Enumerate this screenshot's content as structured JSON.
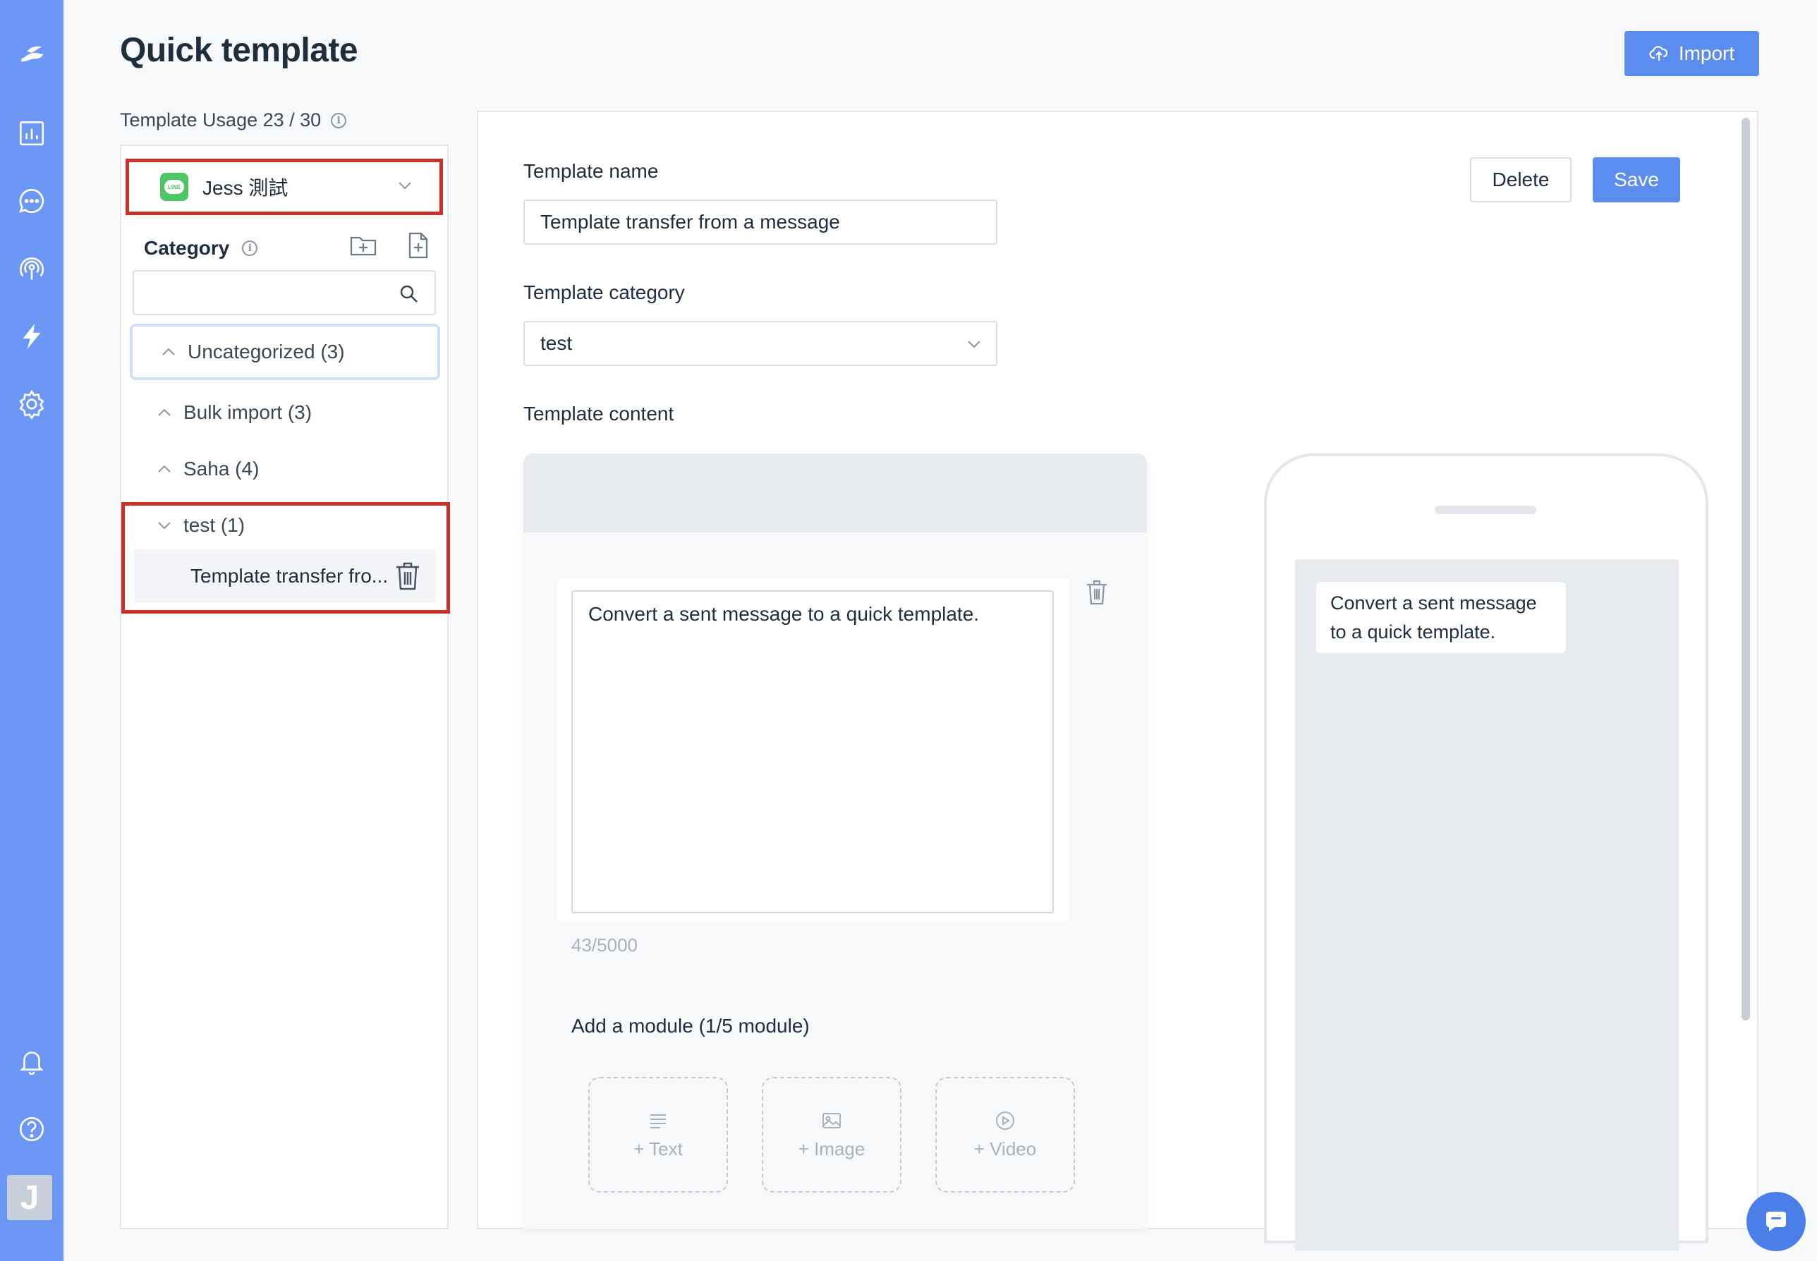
{
  "page": {
    "title": "Quick template",
    "import_label": "Import",
    "usage_label": "Template Usage 23 / 30"
  },
  "nav": {
    "items": [
      "logo-icon",
      "dashboard-icon",
      "chat-icon",
      "broadcast-icon",
      "lightning-icon",
      "settings-icon"
    ],
    "bottom": [
      "bell-icon",
      "help-icon"
    ],
    "avatar_letter": "J"
  },
  "sidebar": {
    "channel_name": "Jess 測試",
    "channel_badge": "LINE",
    "category_title": "Category",
    "search_placeholder": "",
    "categories": [
      {
        "label": "Uncategorized (3)",
        "expanded": false,
        "active": true
      },
      {
        "label": "Bulk import  (3)",
        "expanded": false,
        "active": false
      },
      {
        "label": "Saha  (4)",
        "expanded": false,
        "active": false
      },
      {
        "label": "test  (1)",
        "expanded": true,
        "active": false
      }
    ],
    "templates": [
      {
        "label": "Template transfer fro..."
      }
    ]
  },
  "editor": {
    "name_label": "Template name",
    "name_value": "Template transfer from a message",
    "category_label": "Template category",
    "category_value": "test",
    "content_label": "Template content",
    "delete_label": "Delete",
    "save_label": "Save",
    "message_text": "Convert a sent message to a quick template.",
    "char_count": "43/5000",
    "module_label": "Add a module (1/5 module)",
    "modules": [
      {
        "label": "+ Text",
        "icon": "text-icon"
      },
      {
        "label": "+ Image",
        "icon": "image-icon"
      },
      {
        "label": "+ Video",
        "icon": "video-icon"
      }
    ],
    "preview_text": "Convert a sent message to a quick template."
  },
  "colors": {
    "rail": "#6d97f4",
    "primary": "#5b8def",
    "highlight": "#cc2f26",
    "line_green": "#4cc764"
  }
}
